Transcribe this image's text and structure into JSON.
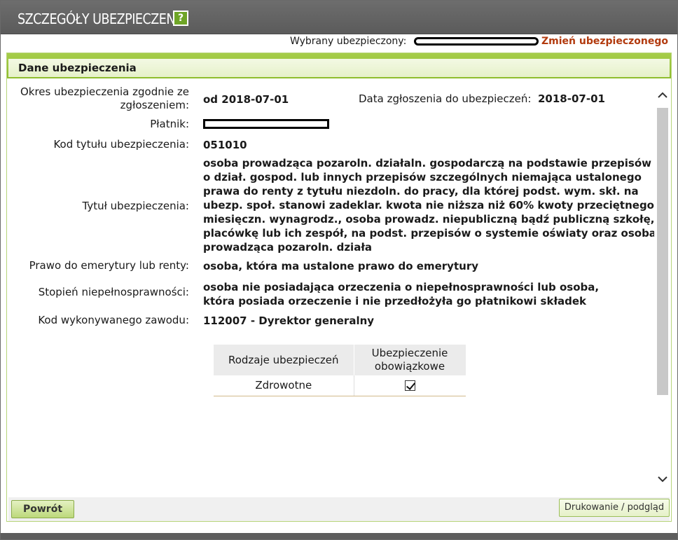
{
  "header": {
    "title": "SZCZEGÓŁY UBEZPIECZENIA",
    "help_label": "?"
  },
  "insured": {
    "label": "Wybrany ubezpieczony:",
    "change_link": "Zmień ubezpieczonego"
  },
  "panel": {
    "title": "Dane ubezpieczenia"
  },
  "details": {
    "period_label": "Okres ubezpieczenia zgodnie ze zgłoszeniem:",
    "period_value": "od 2018-07-01",
    "registration_label": "Data zgłoszenia do ubezpieczeń:",
    "registration_value": "2018-07-01",
    "payer_label": "Płatnik:",
    "title_code_label": "Kod tytułu ubezpieczenia:",
    "title_code_value": "051010",
    "title_label": "Tytuł ubezpieczenia:",
    "title_value": "osoba prowadząca pozaroln. działaln. gospodarczą na podstawie przepisów o dział. gospod. lub innych przepisów szczególnych niemająca ustalonego prawa do renty z tytułu niezdoln. do pracy, dla której podst. wym. skł. na ubezp. społ. stanowi zadeklar. kwota nie niższa niż 60% kwoty przeciętnego miesięczn. wynagrodz., osoba prowadz. niepubliczną bądź publiczną szkołę, placówkę lub ich zespół, na podst. przepisów o systemie oświaty oraz osoba prowadząca pozaroln. działa",
    "pension_label": "Prawo do emerytury lub renty:",
    "pension_value": "osoba, która ma ustalone prawo do emerytury",
    "disability_label": "Stopień niepełnosprawności:",
    "disability_value": "osoba nie posiadająca orzeczenia o niepełnosprawności lub osoba, która posiada orzeczenie i nie przedłożyła go płatnikowi składek",
    "occupation_label": "Kod wykonywanego zawodu:",
    "occupation_value": "112007 - Dyrektor generalny"
  },
  "table": {
    "headers": [
      "Rodzaje ubezpieczeń",
      "Ubezpieczenie obowiązkowe"
    ],
    "rows": [
      {
        "type": "Zdrowotne",
        "mandatory": true
      }
    ]
  },
  "footer": {
    "back_label": "Powrót",
    "print_label": "Drukowanie / podgląd"
  },
  "colors": {
    "accent_green": "#8fbd2e",
    "link": "#b23a0e",
    "titlebar": "#5f5f5f"
  },
  "icons": {
    "help": "help-icon",
    "scroll_up": "chevron-up-icon",
    "scroll_down": "chevron-down-icon",
    "check": "checkmark-icon"
  }
}
